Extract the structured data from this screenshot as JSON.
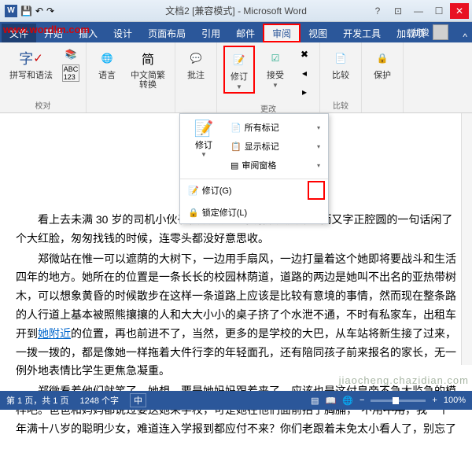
{
  "title": "文档2 [兼容模式] - Microsoft Word",
  "watermark": "www.wordlm.com",
  "right_watermark": "jiaocheng.chazidian.com",
  "tabs": {
    "file": "文件",
    "start": "开始",
    "insert": "插入",
    "design": "设计",
    "layout": "页面布局",
    "references": "引用",
    "mail": "邮件",
    "review": "审阅",
    "view": "视图",
    "developer": "开发工具",
    "addins": "加载项"
  },
  "user": "胡俊",
  "ribbon": {
    "proofing": {
      "spell": "拼写和语法",
      "label": "校对"
    },
    "language": {
      "lang": "语言",
      "convert": "中文简繁\n转换"
    },
    "comments": {
      "new": "批注"
    },
    "tracking": {
      "track": "修订",
      "accept": "接受",
      "label": "更改"
    },
    "compare": {
      "compare": "比较",
      "label": "比较"
    },
    "protect": {
      "protect": "保护"
    }
  },
  "dropdown": {
    "track_btn": "修订",
    "all_markup": "所有标记",
    "show_markup": "显示标记",
    "reviewing_pane": "审阅窗格",
    "track_changes": "修订(G)",
    "lock_tracking": "锁定修订(L)"
  },
  "document": {
    "p1": "看上去未满 30 岁的司机小伙子被眼前这个小姑娘天真可掬而又字正腔圆的一句话闲了个大红脸，匆匆找钱的时候，连零头都没好意思收。",
    "p2_a": "郑微站在惟一可以遮荫的大树下，一边用手扇风，一边打量着这个她即将要战斗和生活四年的地方。她所在的位置是一条长长的校园林荫道，道路的两边是她叫不出名的亚热带树木，可以想象黄昏的时候散步在这样一条道路上应该是比较有意境的事情，然而现在整条路的人行道上基本被照熊攘攘的人和大大小小的桌子挤了个水泄不通，不时有私家车，出租车开到",
    "p2_her": "她附近",
    "p2_b": "的位置，再也前进不了，当然，更多的是学校的大巴，从车站将新生接了过来，一拨一拨的，都是像她一样拖着大件行李的年轻面孔，还有陪同孩子前来报名的家长，无一例外地表情比学生更焦急凝重。",
    "p3_a": "郑微看着他们就笑了，她想，要是她妈妈跟着来了，应该也是这付皇帝不急太监急的模样吧。爸爸和妈妈都说过要送她来学校，可是她在他们面前拍了胸脯，\"不用",
    "p3_strike": "不用",
    "p3_b": "，我一个年满十八岁的聪明少女，难道连入学报到都应付不来？你们老跟着未免太小看人了，别忘了"
  },
  "status": {
    "page": "第 1 页，共 1 页",
    "words": "1248 个字",
    "lang": "中",
    "zoom": "100%"
  }
}
